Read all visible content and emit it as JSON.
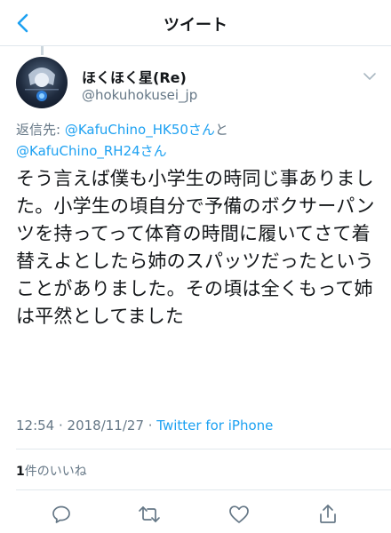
{
  "header": {
    "title": "ツイート",
    "back_icon": "chevron-left-icon"
  },
  "tweet": {
    "display_name": "ほくほく星(Re)",
    "handle": "@hokuhokusei_jp",
    "reply_prefix": "返信先: ",
    "mentions": [
      "@KafuChino_HK50さん",
      "@KafuChino_RH24さん"
    ],
    "reply_joiner": "と",
    "text": "そう言えば僕も小学生の時同じ事ありました。小学生の頃自分で予備のボクサーパンツを持ってって体育の時間に履いてさて着替えよとしたら姉のスパッツだったということがありました。その頃は全くもって姉は平然としてました",
    "timestamp": "12:54 · 2018/11/27 · ",
    "source": "Twitter for iPhone"
  },
  "likes": {
    "count": "1",
    "label": "件のいいね"
  },
  "actions": {
    "icons": [
      "reply-icon",
      "retweet-icon",
      "like-icon",
      "share-icon"
    ]
  },
  "colors": {
    "accent": "#1da1f2",
    "secondary_text": "#657786",
    "primary_text": "#14171a",
    "divider": "#e1e8ed"
  }
}
